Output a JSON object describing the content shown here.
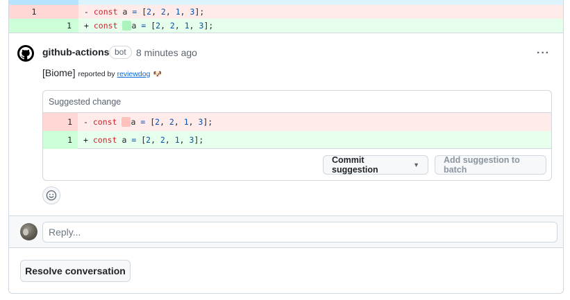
{
  "top_diff": {
    "deleted": {
      "old_line": "1",
      "sign": "-",
      "keyword": "const",
      "var": "a",
      "eq": "=",
      "array_open": "[",
      "nums": [
        "2",
        "2",
        "1",
        "3"
      ],
      "close": "];"
    },
    "added": {
      "new_line": "1",
      "sign": "+",
      "keyword": "const",
      "var": "a",
      "eq": "=",
      "array_open": "[",
      "nums": [
        "2",
        "2",
        "1",
        "3"
      ],
      "close": "];"
    }
  },
  "comment": {
    "author": "github-actions",
    "badge": "bot",
    "time": "8 minutes ago",
    "tag": "[Biome]",
    "reported_by": "reported by",
    "reporter_link": "reviewdog",
    "reporter_emoji": "🐶",
    "more_icon": "kebab-horizontal-icon"
  },
  "suggestion": {
    "header": "Suggested change",
    "deleted": {
      "line": "1",
      "sign": "-",
      "keyword": "const",
      "var": "a",
      "eq": "=",
      "array_open": "[",
      "nums": [
        "2",
        "2",
        "1",
        "3"
      ],
      "close": "];"
    },
    "added": {
      "line": "1",
      "sign": "+",
      "keyword": "const",
      "var": "a",
      "eq": "=",
      "array_open": "[",
      "nums": [
        "2",
        "2",
        "1",
        "3"
      ],
      "close": "];"
    },
    "commit_label": "Commit suggestion",
    "batch_label": "Add suggestion to batch"
  },
  "reply": {
    "placeholder": "Reply..."
  },
  "resolve_label": "Resolve conversation",
  "colors": {
    "deleted_bg": "#ffebe9",
    "added_bg": "#e6ffec",
    "keyword": "#cf222e",
    "number": "#0550ae",
    "link": "#0969da"
  }
}
